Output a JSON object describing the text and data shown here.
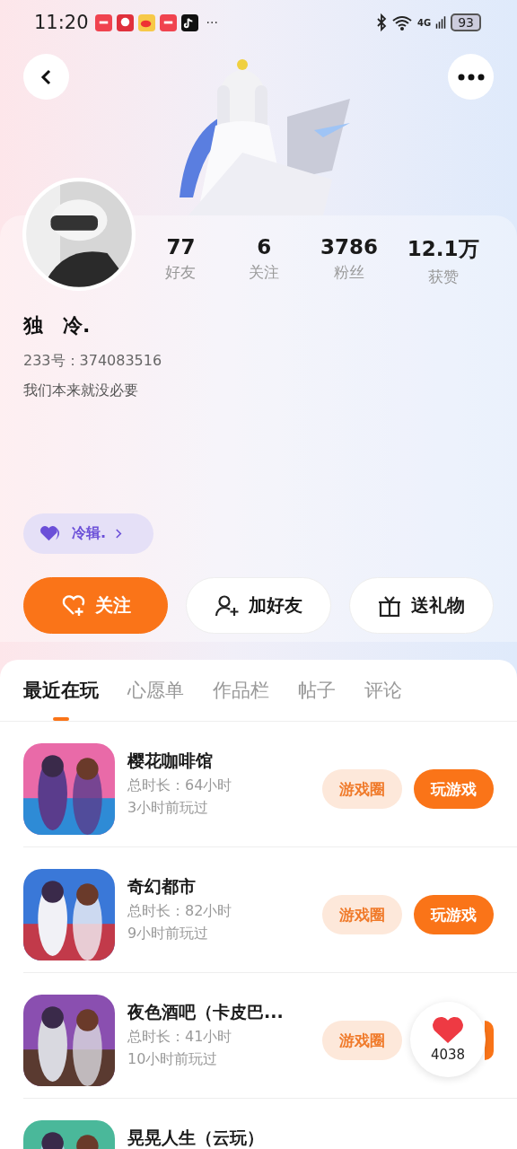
{
  "status_bar": {
    "time": "11:20",
    "more": "···",
    "network": "4G",
    "battery": "93"
  },
  "stats": [
    {
      "value": "77",
      "label": "好友"
    },
    {
      "value": "6",
      "label": "关注"
    },
    {
      "value": "3786",
      "label": "粉丝"
    },
    {
      "value": "12.1万",
      "label": "获赞"
    }
  ],
  "profile": {
    "name": "独　冷.",
    "id_label": "233号：374083516",
    "bio": "我们本来就没必要",
    "tag": "冷辑."
  },
  "actions": [
    {
      "kind": "follow",
      "label": "关注"
    },
    {
      "kind": "add_friend",
      "label": "加好友"
    },
    {
      "kind": "gift",
      "label": "送礼物"
    }
  ],
  "tabs": [
    {
      "label": "最近在玩",
      "selected": true
    },
    {
      "label": "心愿单",
      "selected": false
    },
    {
      "label": "作品栏",
      "selected": false
    },
    {
      "label": "帖子",
      "selected": false
    },
    {
      "label": "评论",
      "selected": false
    }
  ],
  "games": [
    {
      "title": "樱花咖啡馆",
      "duration": "总时长：64小时",
      "last_played": "3小时前玩过",
      "circle": "游戏圈",
      "play": "玩游戏"
    },
    {
      "title": "奇幻都市",
      "duration": "总时长：82小时",
      "last_played": "9小时前玩过",
      "circle": "游戏圈",
      "play": "玩游戏"
    },
    {
      "title": "夜色酒吧（卡皮巴...",
      "duration": "总时长：41小时",
      "last_played": "10小时前玩过",
      "circle": "游戏圈"
    },
    {
      "title": "晃晃人生（云玩）"
    }
  ],
  "like_float": {
    "count": "4038"
  }
}
